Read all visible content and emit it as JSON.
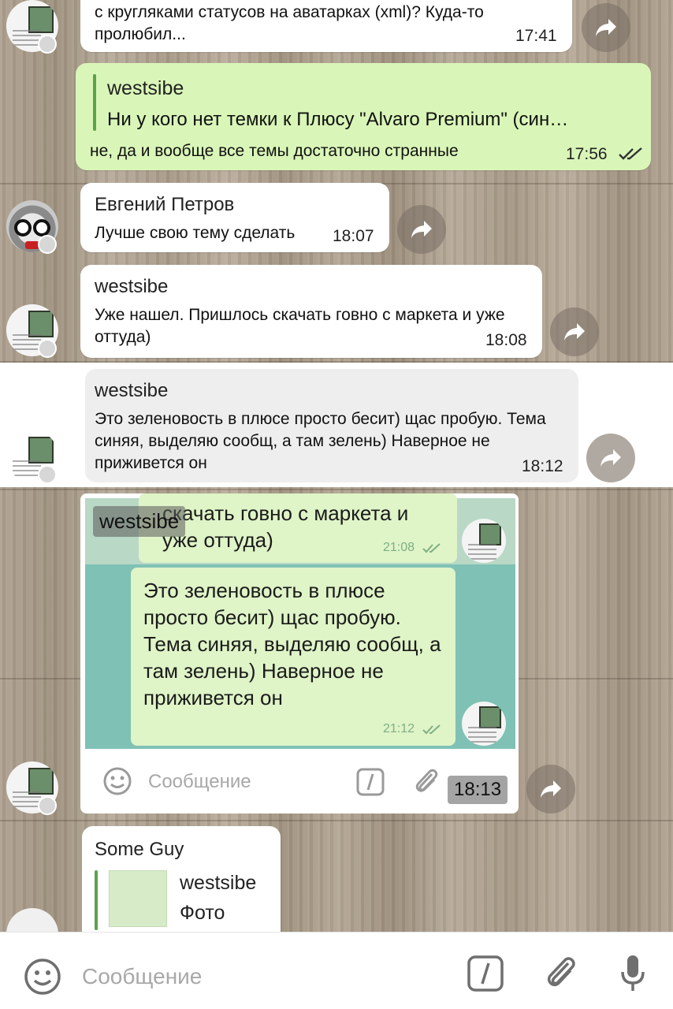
{
  "messages": {
    "m1": {
      "text": "с кругляками статусов на аватарках (xml)? Куда-то пролюбил...",
      "time": "17:41"
    },
    "m2": {
      "quote_author": "westsibe",
      "quote_text": "Ни у кого нет темки к Плюсу \"Alvaro Premium\" (син…",
      "text": "не, да и вообще все темы достаточно странные",
      "time": "17:56"
    },
    "m3": {
      "sender": "Евгений Петров",
      "text": "Лучше свою тему сделать",
      "time": "18:07"
    },
    "m4": {
      "sender": "westsibe",
      "text": "Уже нашел. Пришлось скачать говно с маркета и уже оттуда)",
      "time": "18:08"
    },
    "m5": {
      "sender": "westsibe",
      "text": "Это зеленовость в плюсе просто бесит) щас пробую. Тема синяя, выделяю сообщ, а там зелень) Наверное не приживется он",
      "time": "18:12"
    },
    "m6": {
      "sender": "westsibe",
      "time": "18:13",
      "screenshot": {
        "top_text": "скачать говно с маркета и уже оттуда)",
        "top_time": "21:08",
        "text": "Это зеленовость в плюсе просто бесит) щас пробую. Тема синяя, выделяю сообщ, а там зелень) Наверное не приживется он",
        "time": "21:12",
        "compose_placeholder": "Сообщение"
      }
    },
    "m7": {
      "sender": "Some Guy",
      "reply_author": "westsibe",
      "reply_text": "Фото"
    }
  },
  "composer": {
    "placeholder": "Сообщение"
  },
  "colors": {
    "outgoing_bubble": "#d9f6b8",
    "incoming_bubble": "#ffffff",
    "accent": "#5aa34a"
  }
}
